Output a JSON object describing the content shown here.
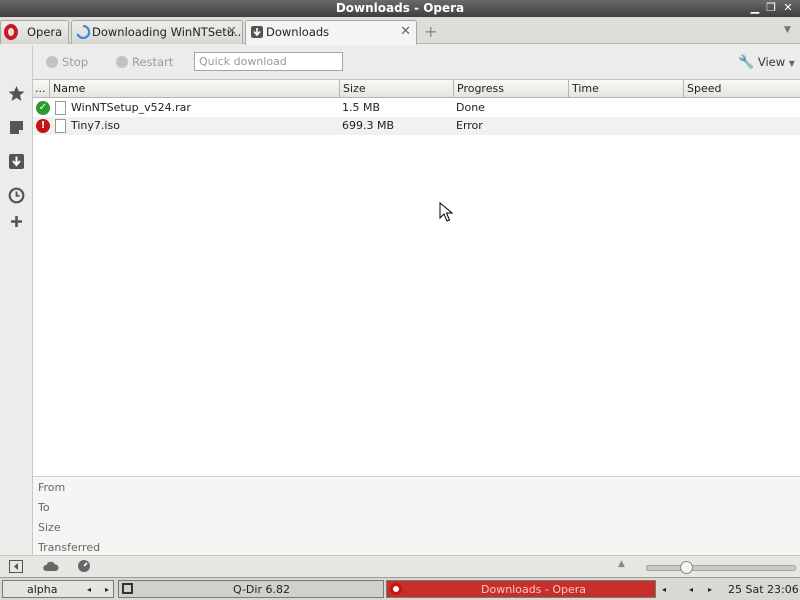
{
  "window": {
    "title": "Downloads - Opera"
  },
  "tabs": [
    {
      "label": "Opera"
    },
    {
      "label": "Downloading WinNTSetu..."
    },
    {
      "label": "Downloads"
    }
  ],
  "toolbar": {
    "stop_label": "Stop",
    "restart_label": "Restart",
    "quick_download_placeholder": "Quick download",
    "view_label": "View"
  },
  "table": {
    "columns": [
      "...",
      "Name",
      "Size",
      "Progress",
      "Time",
      "Speed"
    ],
    "rows": [
      {
        "status": "done",
        "name": "WinNTSetup_v524.rar",
        "size": "1.5 MB",
        "progress": "Done",
        "time": "",
        "speed": ""
      },
      {
        "status": "error",
        "name": "Tiny7.iso",
        "size": "699.3 MB",
        "progress": "Error",
        "time": "",
        "speed": ""
      }
    ]
  },
  "details": {
    "from_label": "From",
    "to_label": "To",
    "size_label": "Size",
    "transferred_label": "Transferred"
  },
  "taskbar": {
    "workspace": "alpha",
    "app1": "Q-Dir 6.82",
    "app2": "Downloads - Opera",
    "clock": "25 Sat 23:06"
  },
  "colors": {
    "opera_red": "#cc1a1a",
    "done_green": "#2e9a2e",
    "error_red": "#c41414"
  }
}
